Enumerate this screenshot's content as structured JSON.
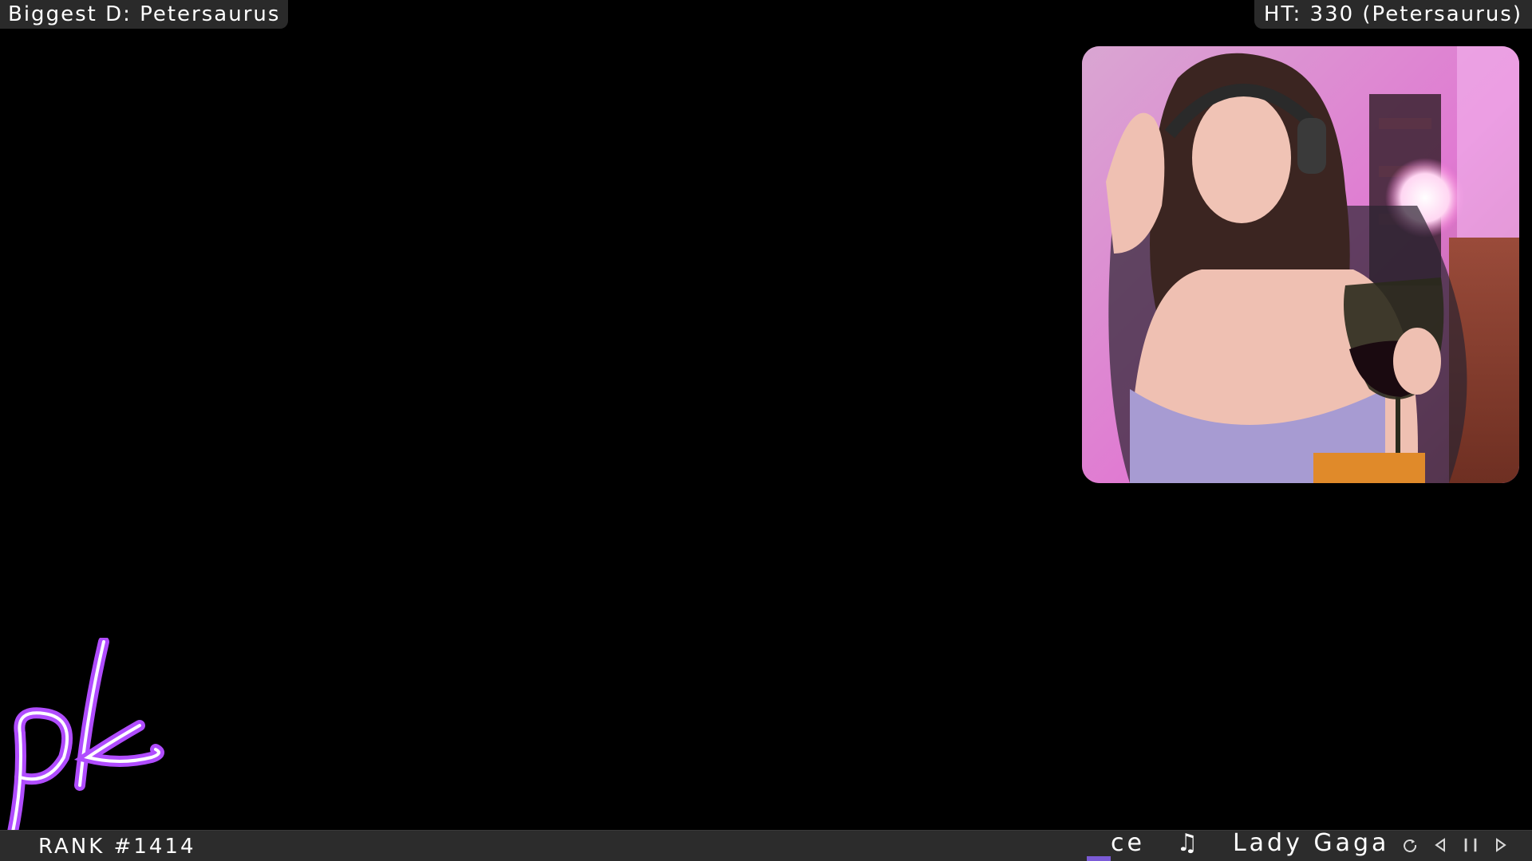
{
  "overlay": {
    "top_left_label": "Biggest D: Petersaurus",
    "top_right_label": "HT: 330 (Petersaurus)"
  },
  "webcam": {
    "description_icon": "webcam-feed"
  },
  "logo": {
    "text": "pk",
    "color": "#b04cff"
  },
  "bottom_bar": {
    "rank_label": "RANK #1414",
    "now_playing_fragment": "ce",
    "music_note": "♫",
    "artist": "Lady Gaga",
    "controls": {
      "repeat_icon": "repeat-icon",
      "prev_icon": "previous-icon",
      "pause_icon": "pause-icon",
      "next_icon": "next-icon"
    }
  },
  "colors": {
    "background": "#000000",
    "bar": "#2c2c2c",
    "accent": "#7b5bd6"
  }
}
